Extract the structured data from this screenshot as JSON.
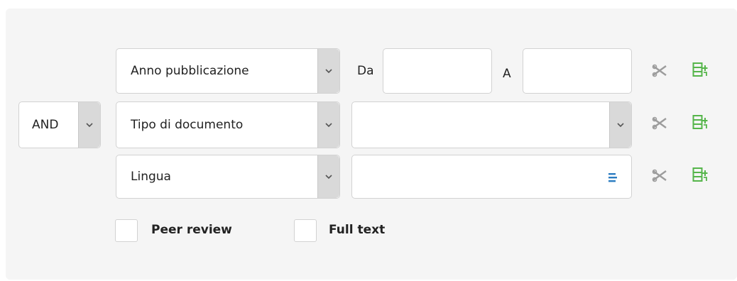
{
  "operator": {
    "value": "AND"
  },
  "rows": [
    {
      "field": "Anno pubblicazione",
      "from_label": "Da",
      "from_value": "",
      "to_label": "A",
      "to_value": ""
    },
    {
      "field": "Tipo di documento",
      "value": ""
    },
    {
      "field": "Lingua",
      "value": ""
    }
  ],
  "icons": {
    "remove": "scissors-icon",
    "add": "add-row-icon",
    "list": "list-icon"
  },
  "options": {
    "peer_review": {
      "label": "Peer review",
      "checked": false
    },
    "full_text": {
      "label": "Full text",
      "checked": false
    }
  },
  "colors": {
    "add_icon": "#55b54a",
    "remove_icon": "#9c9c9c",
    "list_icon": "#2b7cc1",
    "panel_bg": "#f5f5f5"
  }
}
